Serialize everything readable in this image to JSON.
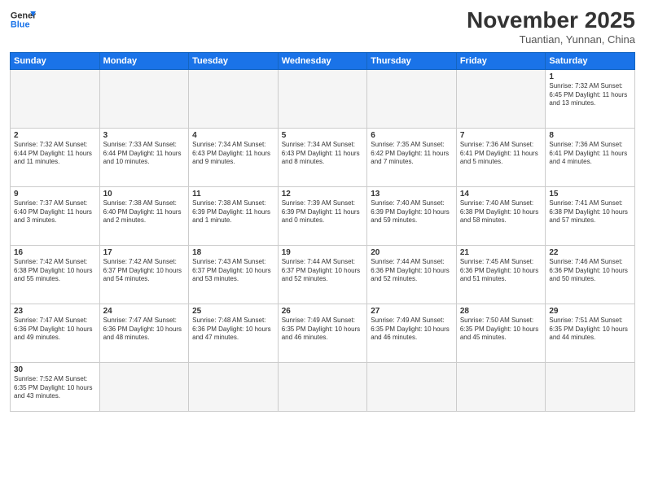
{
  "header": {
    "logo_general": "General",
    "logo_blue": "Blue",
    "month_year": "November 2025",
    "location": "Tuantian, Yunnan, China"
  },
  "days_of_week": [
    "Sunday",
    "Monday",
    "Tuesday",
    "Wednesday",
    "Thursday",
    "Friday",
    "Saturday"
  ],
  "weeks": [
    {
      "days": [
        {
          "num": "",
          "info": "",
          "empty": true
        },
        {
          "num": "",
          "info": "",
          "empty": true
        },
        {
          "num": "",
          "info": "",
          "empty": true
        },
        {
          "num": "",
          "info": "",
          "empty": true
        },
        {
          "num": "",
          "info": "",
          "empty": true
        },
        {
          "num": "",
          "info": "",
          "empty": true
        },
        {
          "num": "1",
          "info": "Sunrise: 7:32 AM\nSunset: 6:45 PM\nDaylight: 11 hours and 13 minutes.",
          "empty": false
        }
      ]
    },
    {
      "days": [
        {
          "num": "2",
          "info": "Sunrise: 7:32 AM\nSunset: 6:44 PM\nDaylight: 11 hours and 11 minutes.",
          "empty": false
        },
        {
          "num": "3",
          "info": "Sunrise: 7:33 AM\nSunset: 6:44 PM\nDaylight: 11 hours and 10 minutes.",
          "empty": false
        },
        {
          "num": "4",
          "info": "Sunrise: 7:34 AM\nSunset: 6:43 PM\nDaylight: 11 hours and 9 minutes.",
          "empty": false
        },
        {
          "num": "5",
          "info": "Sunrise: 7:34 AM\nSunset: 6:43 PM\nDaylight: 11 hours and 8 minutes.",
          "empty": false
        },
        {
          "num": "6",
          "info": "Sunrise: 7:35 AM\nSunset: 6:42 PM\nDaylight: 11 hours and 7 minutes.",
          "empty": false
        },
        {
          "num": "7",
          "info": "Sunrise: 7:36 AM\nSunset: 6:41 PM\nDaylight: 11 hours and 5 minutes.",
          "empty": false
        },
        {
          "num": "8",
          "info": "Sunrise: 7:36 AM\nSunset: 6:41 PM\nDaylight: 11 hours and 4 minutes.",
          "empty": false
        }
      ]
    },
    {
      "days": [
        {
          "num": "9",
          "info": "Sunrise: 7:37 AM\nSunset: 6:40 PM\nDaylight: 11 hours and 3 minutes.",
          "empty": false
        },
        {
          "num": "10",
          "info": "Sunrise: 7:38 AM\nSunset: 6:40 PM\nDaylight: 11 hours and 2 minutes.",
          "empty": false
        },
        {
          "num": "11",
          "info": "Sunrise: 7:38 AM\nSunset: 6:39 PM\nDaylight: 11 hours and 1 minute.",
          "empty": false
        },
        {
          "num": "12",
          "info": "Sunrise: 7:39 AM\nSunset: 6:39 PM\nDaylight: 11 hours and 0 minutes.",
          "empty": false
        },
        {
          "num": "13",
          "info": "Sunrise: 7:40 AM\nSunset: 6:39 PM\nDaylight: 10 hours and 59 minutes.",
          "empty": false
        },
        {
          "num": "14",
          "info": "Sunrise: 7:40 AM\nSunset: 6:38 PM\nDaylight: 10 hours and 58 minutes.",
          "empty": false
        },
        {
          "num": "15",
          "info": "Sunrise: 7:41 AM\nSunset: 6:38 PM\nDaylight: 10 hours and 57 minutes.",
          "empty": false
        }
      ]
    },
    {
      "days": [
        {
          "num": "16",
          "info": "Sunrise: 7:42 AM\nSunset: 6:38 PM\nDaylight: 10 hours and 55 minutes.",
          "empty": false
        },
        {
          "num": "17",
          "info": "Sunrise: 7:42 AM\nSunset: 6:37 PM\nDaylight: 10 hours and 54 minutes.",
          "empty": false
        },
        {
          "num": "18",
          "info": "Sunrise: 7:43 AM\nSunset: 6:37 PM\nDaylight: 10 hours and 53 minutes.",
          "empty": false
        },
        {
          "num": "19",
          "info": "Sunrise: 7:44 AM\nSunset: 6:37 PM\nDaylight: 10 hours and 52 minutes.",
          "empty": false
        },
        {
          "num": "20",
          "info": "Sunrise: 7:44 AM\nSunset: 6:36 PM\nDaylight: 10 hours and 52 minutes.",
          "empty": false
        },
        {
          "num": "21",
          "info": "Sunrise: 7:45 AM\nSunset: 6:36 PM\nDaylight: 10 hours and 51 minutes.",
          "empty": false
        },
        {
          "num": "22",
          "info": "Sunrise: 7:46 AM\nSunset: 6:36 PM\nDaylight: 10 hours and 50 minutes.",
          "empty": false
        }
      ]
    },
    {
      "days": [
        {
          "num": "23",
          "info": "Sunrise: 7:47 AM\nSunset: 6:36 PM\nDaylight: 10 hours and 49 minutes.",
          "empty": false
        },
        {
          "num": "24",
          "info": "Sunrise: 7:47 AM\nSunset: 6:36 PM\nDaylight: 10 hours and 48 minutes.",
          "empty": false
        },
        {
          "num": "25",
          "info": "Sunrise: 7:48 AM\nSunset: 6:36 PM\nDaylight: 10 hours and 47 minutes.",
          "empty": false
        },
        {
          "num": "26",
          "info": "Sunrise: 7:49 AM\nSunset: 6:35 PM\nDaylight: 10 hours and 46 minutes.",
          "empty": false
        },
        {
          "num": "27",
          "info": "Sunrise: 7:49 AM\nSunset: 6:35 PM\nDaylight: 10 hours and 46 minutes.",
          "empty": false
        },
        {
          "num": "28",
          "info": "Sunrise: 7:50 AM\nSunset: 6:35 PM\nDaylight: 10 hours and 45 minutes.",
          "empty": false
        },
        {
          "num": "29",
          "info": "Sunrise: 7:51 AM\nSunset: 6:35 PM\nDaylight: 10 hours and 44 minutes.",
          "empty": false
        }
      ]
    },
    {
      "days": [
        {
          "num": "30",
          "info": "Sunrise: 7:52 AM\nSunset: 6:35 PM\nDaylight: 10 hours and 43 minutes.",
          "empty": false
        },
        {
          "num": "",
          "info": "",
          "empty": true
        },
        {
          "num": "",
          "info": "",
          "empty": true
        },
        {
          "num": "",
          "info": "",
          "empty": true
        },
        {
          "num": "",
          "info": "",
          "empty": true
        },
        {
          "num": "",
          "info": "",
          "empty": true
        },
        {
          "num": "",
          "info": "",
          "empty": true
        }
      ]
    }
  ]
}
